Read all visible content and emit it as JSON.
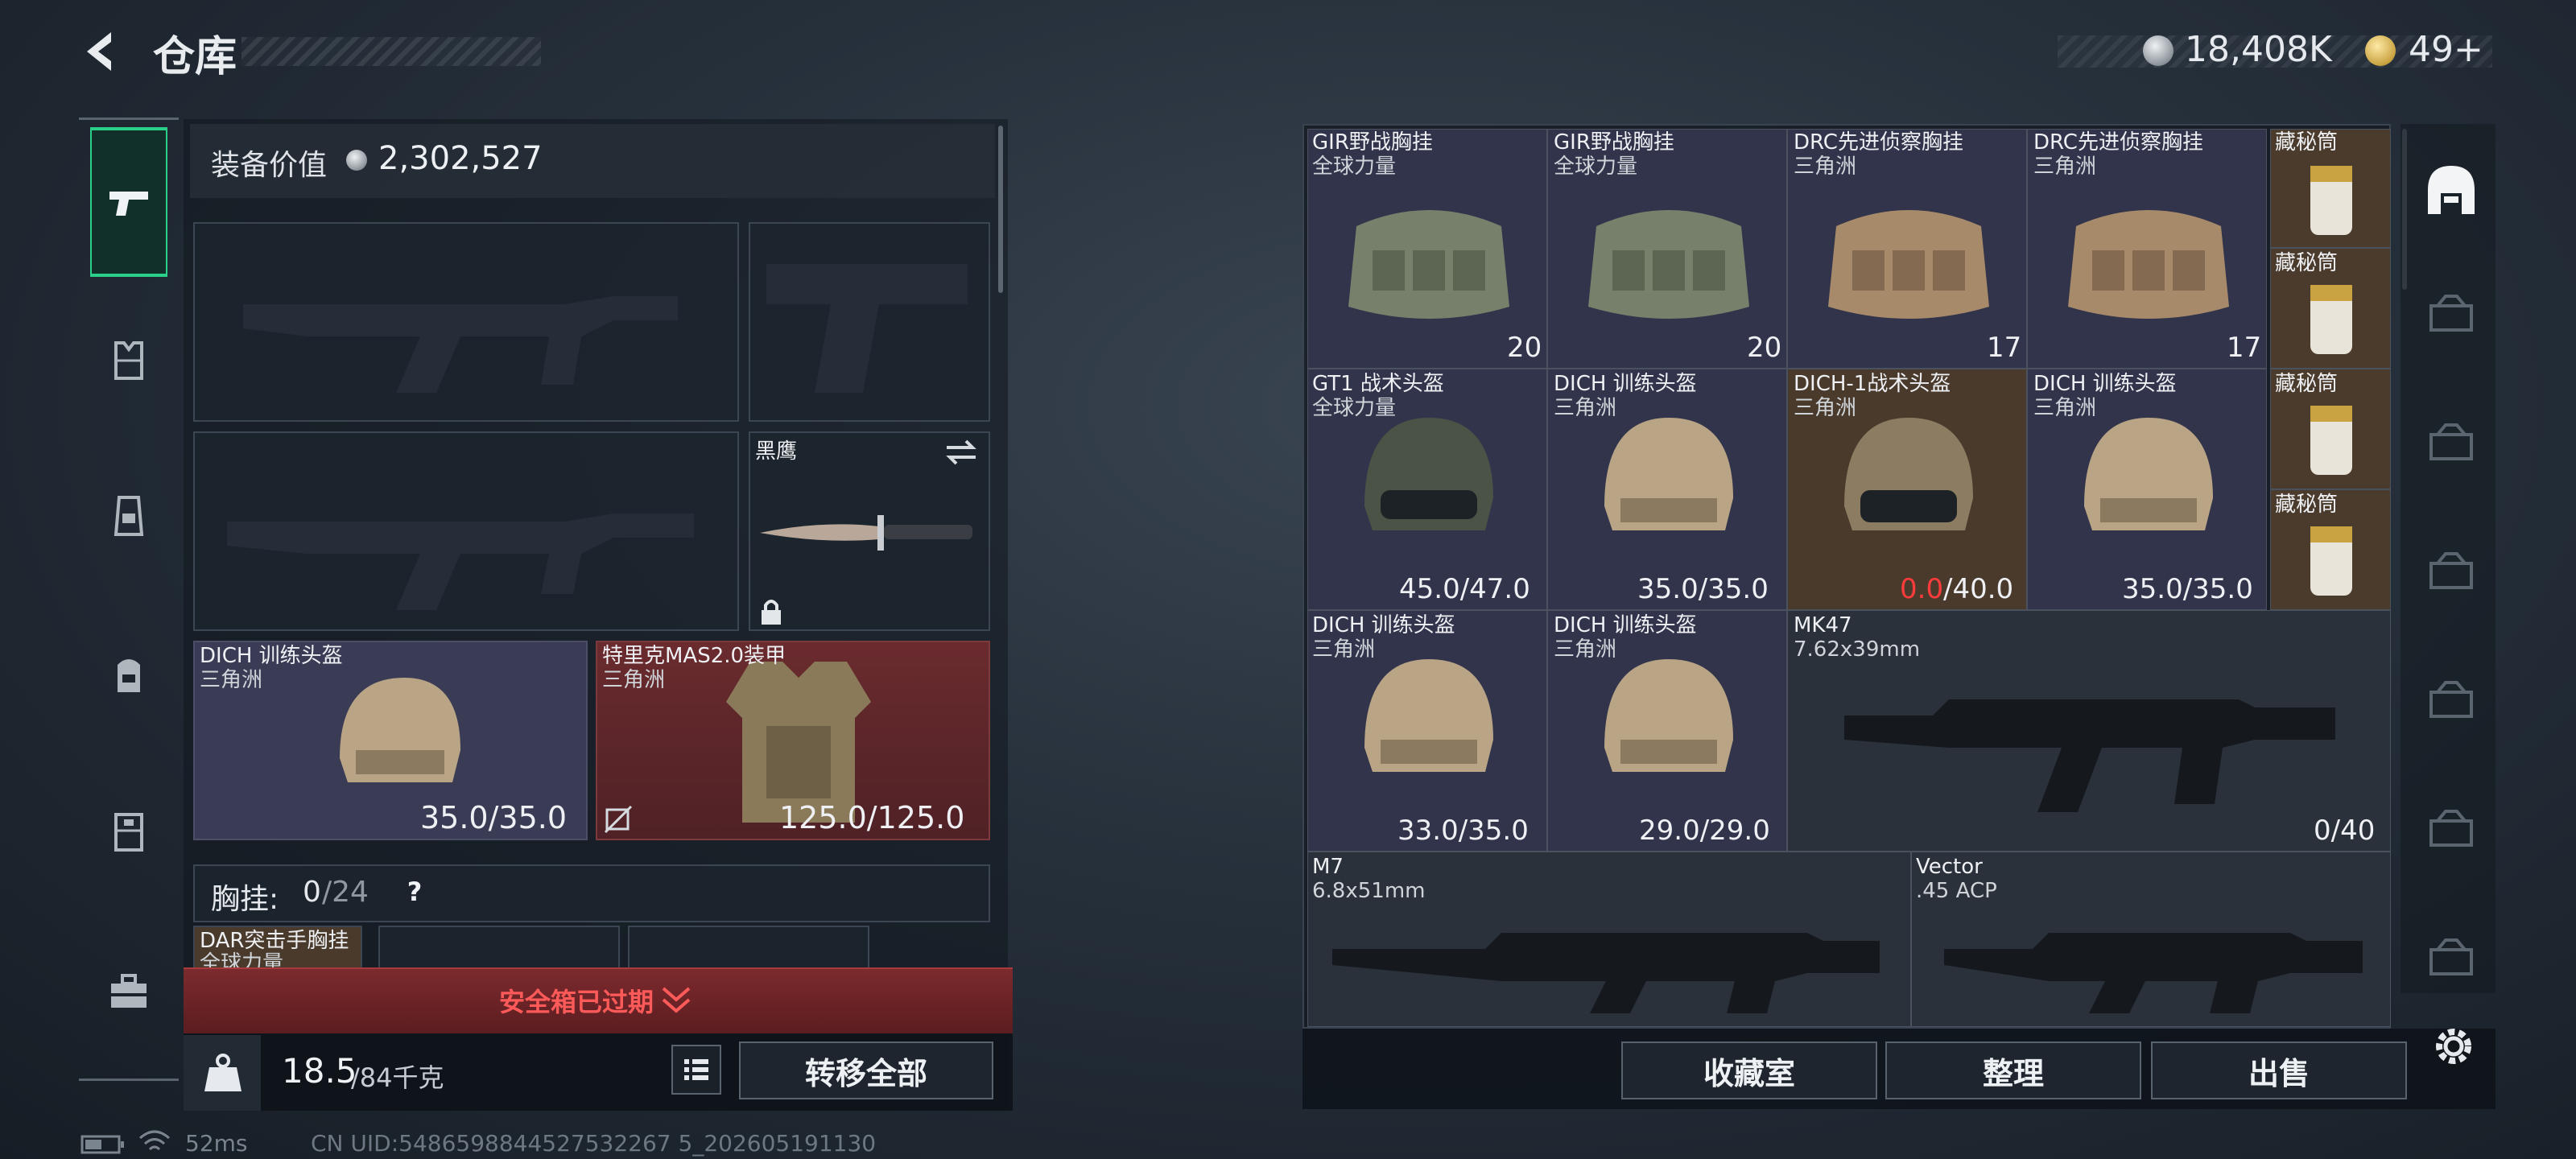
{
  "header": {
    "title": "仓库"
  },
  "currency": {
    "coins": "18,408K",
    "gold": "49+"
  },
  "left": {
    "equipment_value_label": "装备价值",
    "equipment_value": "2,302,527",
    "knife_name": "黑鹰",
    "helmet": {
      "name": "DICH 训练头盔",
      "faction": "三角洲",
      "durability": "35.0/35.0"
    },
    "armor": {
      "name": "特里克MAS2.0装甲",
      "faction": "三角洲",
      "durability": "125.0/125.0"
    },
    "chest_rig_label": "胸挂:",
    "chest_rig_used": "0",
    "chest_rig_total": "/24",
    "chest_rig_help": "?",
    "rig_item": {
      "name": "DAR突击手胸挂",
      "faction": "全球力量"
    },
    "safe_box_text": "安全箱已过期",
    "weight_current": "18.5",
    "weight_total": "/84千克",
    "transfer_all": "转移全部"
  },
  "grid": {
    "row1": [
      {
        "name": "GIR野战胸挂",
        "faction": "全球力量",
        "count": "20"
      },
      {
        "name": "GIR野战胸挂",
        "faction": "全球力量",
        "count": "20"
      },
      {
        "name": "DRC先进侦察胸挂",
        "faction": "三角洲",
        "count": "17"
      },
      {
        "name": "DRC先进侦察胸挂",
        "faction": "三角洲",
        "count": "17"
      }
    ],
    "row2": [
      {
        "name": "GT1 战术头盔",
        "faction": "全球力量",
        "durability": "45.0/47.0"
      },
      {
        "name": "DICH 训练头盔",
        "faction": "三角洲",
        "durability": "35.0/35.0"
      },
      {
        "name": "DICH-1战术头盔",
        "faction": "三角洲",
        "durability_low": "0.0",
        "durability_max": "/40.0"
      },
      {
        "name": "DICH 训练头盔",
        "faction": "三角洲",
        "durability": "35.0/35.0"
      }
    ],
    "row3": [
      {
        "name": "DICH 训练头盔",
        "faction": "三角洲",
        "durability": "33.0/35.0"
      },
      {
        "name": "DICH 训练头盔",
        "faction": "三角洲",
        "durability": "29.0/29.0"
      }
    ],
    "mk47": {
      "name": "MK47",
      "caliber": "7.62x39mm",
      "ammo": "0/40"
    },
    "m7": {
      "name": "M7",
      "caliber": "6.8x51mm"
    },
    "vector": {
      "name": "Vector",
      "caliber": ".45 ACP"
    },
    "ammo_label": "藏秘筒"
  },
  "actions": {
    "collection": "收藏室",
    "sort": "整理",
    "sell": "出售"
  },
  "status": {
    "ping": "52ms",
    "uid": "CN UID:5486598844527532267 5_202605191130"
  },
  "colors": {
    "accent_green": "#2ad08a",
    "low_durability": "#ff3b3b",
    "safe_box_red": "#7c2a2d"
  }
}
